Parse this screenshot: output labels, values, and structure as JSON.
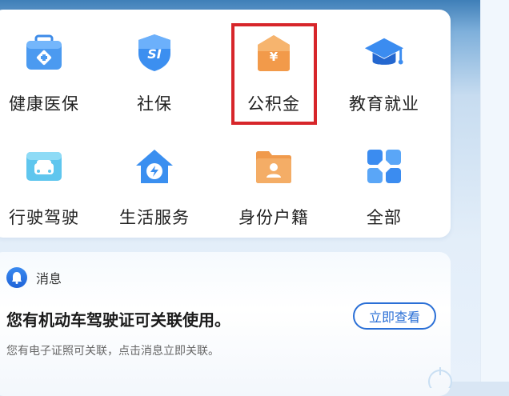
{
  "grid": {
    "items": [
      {
        "label": "健康医保",
        "icon": "medical-kit-icon"
      },
      {
        "label": "社保",
        "icon": "social-security-shield-icon"
      },
      {
        "label": "公积金",
        "icon": "housing-fund-yuan-icon"
      },
      {
        "label": "教育就业",
        "icon": "graduation-cap-icon"
      },
      {
        "label": "行驶驾驶",
        "icon": "car-license-icon"
      },
      {
        "label": "生活服务",
        "icon": "home-service-icon"
      },
      {
        "label": "身份户籍",
        "icon": "id-folder-icon"
      },
      {
        "label": "全部",
        "icon": "all-grid-icon"
      }
    ],
    "highlighted": "公积金"
  },
  "message": {
    "header_label": "消息",
    "title": "您有机动车驾驶证可关联使用。",
    "subtitle": "您有电子证照可关联，点击消息立即关联。",
    "button_label": "立即查看"
  },
  "colors": {
    "highlight_border": "#d7262a",
    "accent_blue": "#2a6fd6"
  }
}
